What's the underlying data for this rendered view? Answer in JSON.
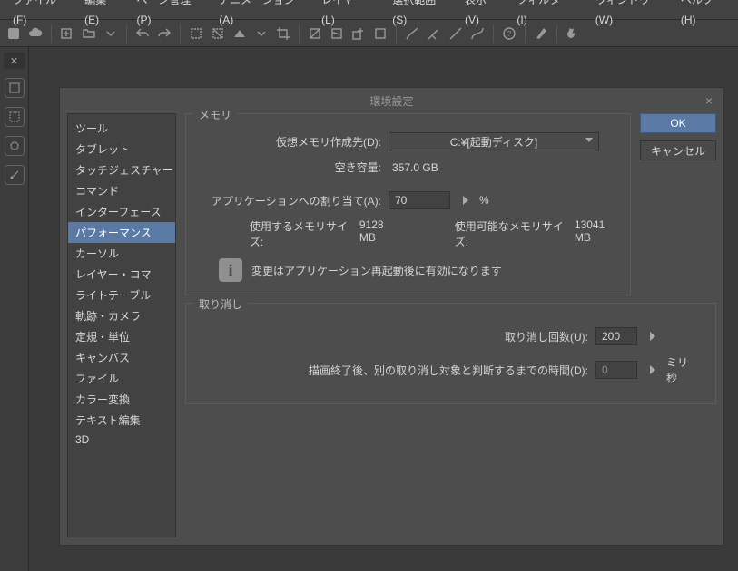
{
  "menu": {
    "items": [
      "ファイル(F)",
      "編集(E)",
      "ページ管理(P)",
      "アニメーション(A)",
      "レイヤー(L)",
      "選択範囲(S)",
      "表示(V)",
      "フィルター(I)",
      "ウィンドウ(W)",
      "ヘルプ(H)"
    ]
  },
  "dialog": {
    "title": "環境設定",
    "close": "×",
    "ok": "OK",
    "cancel": "キャンセル",
    "categories": [
      "ツール",
      "タブレット",
      "タッチジェスチャー",
      "コマンド",
      "インターフェース",
      "パフォーマンス",
      "カーソル",
      "レイヤー・コマ",
      "ライトテーブル",
      "軌跡・カメラ",
      "定規・単位",
      "キャンバス",
      "ファイル",
      "カラー変換",
      "テキスト編集",
      "3D"
    ],
    "selected_index": 5,
    "memory": {
      "legend": "メモリ",
      "vm_label": "仮想メモリ作成先(D):",
      "vm_value": "C:¥[起動ディスク]",
      "free_label": "空き容量:",
      "free_value": "357.0 GB",
      "alloc_label": "アプリケーションへの割り当て(A):",
      "alloc_value": "70",
      "alloc_suffix": "%",
      "use_size_label": "使用するメモリサイズ:",
      "use_size_value": "9128 MB",
      "avail_label": "使用可能なメモリサイズ:",
      "avail_value": "13041 MB",
      "info": "変更はアプリケーション再起動後に有効になります"
    },
    "undo": {
      "legend": "取り消し",
      "count_label": "取り消し回数(U):",
      "count_value": "200",
      "time_label": "描画終了後、別の取り消し対象と判断するまでの時間(D):",
      "time_value": "0",
      "time_suffix": "ミリ秒"
    }
  }
}
